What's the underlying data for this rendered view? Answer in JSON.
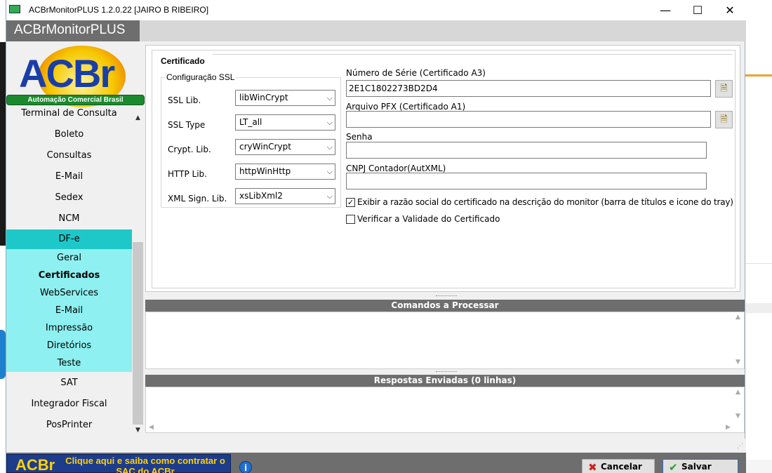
{
  "window": {
    "title": "ACBrMonitorPLUS 1.2.0.22  [JAIRO B RIBEIRO]",
    "app_name": "ACBrMonitorPLUS",
    "minimize_glyph": "—",
    "maximize_glyph": "☐",
    "close_glyph": "✕"
  },
  "logo": {
    "text_ac": "AC",
    "text_br": "Br",
    "tagline": "Automação Comercial Brasil"
  },
  "sidebar": {
    "items": [
      {
        "label": "Terminal de Consulta"
      },
      {
        "label": "Boleto"
      },
      {
        "label": "Consultas"
      },
      {
        "label": "E-Mail"
      },
      {
        "label": "Sedex"
      },
      {
        "label": "NCM"
      },
      {
        "label": "DF-e"
      },
      {
        "label": "Geral"
      },
      {
        "label": "Certificados"
      },
      {
        "label": "WebServices"
      },
      {
        "label": "E-Mail"
      },
      {
        "label": "Impressão"
      },
      {
        "label": "Diretórios"
      },
      {
        "label": "Teste"
      },
      {
        "label": "SAT"
      },
      {
        "label": "Integrador Fiscal"
      },
      {
        "label": "PosPrinter"
      }
    ]
  },
  "certificado": {
    "section_title": "Certificado",
    "ssl_group_title": "Configuração SSL",
    "ssl_lib_label": "SSL Lib.",
    "ssl_lib_value": "libWinCrypt",
    "ssl_type_label": "SSL Type",
    "ssl_type_value": "LT_all",
    "crypt_lib_label": "Crypt. Lib.",
    "crypt_lib_value": "cryWinCrypt",
    "http_lib_label": "HTTP Lib.",
    "http_lib_value": "httpWinHttp",
    "xml_sign_label": "XML Sign. Lib.",
    "xml_sign_value": "xsLibXml2",
    "serial_label": "Número de Série (Certificado A3)",
    "serial_value": "2E1C1802273BD2D4",
    "pfx_label": "Arquivo PFX (Certificado A1)",
    "pfx_value": "",
    "senha_label": "Senha",
    "senha_value": "",
    "cnpj_label": "CNPJ Contador(AutXML)",
    "cnpj_value": "",
    "exibir_label": "Exibir a razão social do certificado na descrição do monitor (barra de títulos e icone do tray)",
    "exibir_checked": true,
    "verificar_label": "Verificar a Validade do Certificado",
    "verificar_checked": false
  },
  "comandos": {
    "title": "Comandos a Processar"
  },
  "respostas": {
    "title": "Respostas Enviadas (0 linhas)"
  },
  "bottom": {
    "banner_logo": "ACBr",
    "banner_text": "Clique aqui e saiba como contratar o SAC do ACBr",
    "info_glyph": "i",
    "cancelar_label": "Cancelar",
    "salvar_label": "Salvar"
  },
  "colors": {
    "selected_item": "#1fc8c8",
    "sub_items": "#8ef0f0",
    "header_gray": "#6e6e6e"
  }
}
